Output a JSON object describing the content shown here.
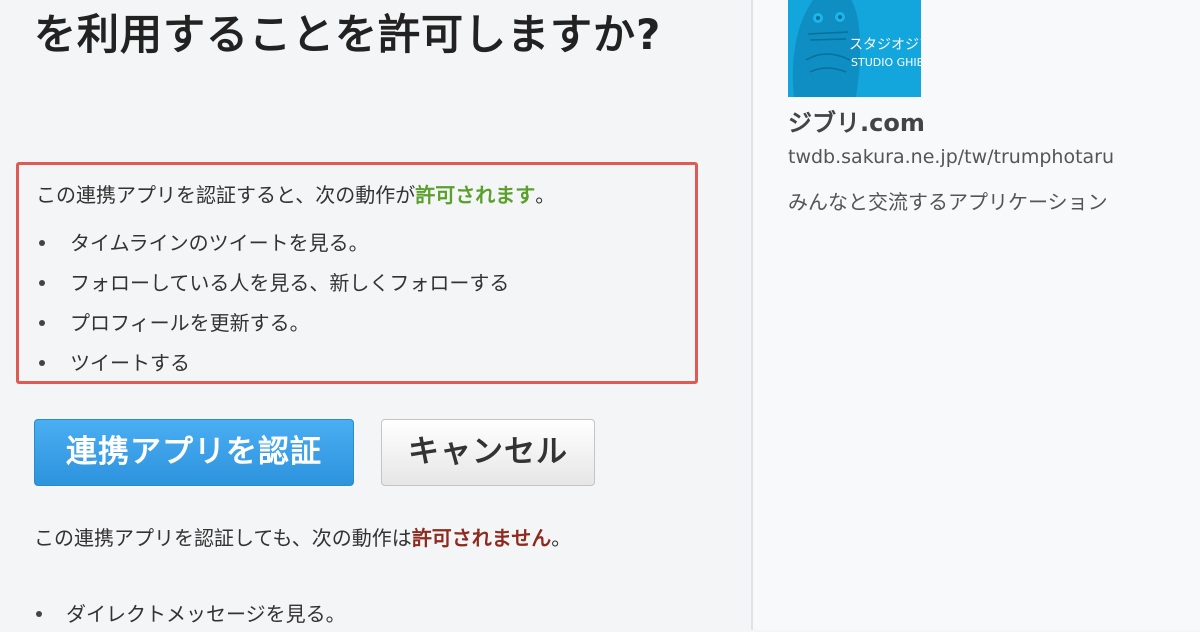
{
  "main": {
    "title": "ジブリ.comがあなたのアカウントを利用することを許可しますか?",
    "allowed": {
      "intro": "この連携アプリを認証すると、次の動作が",
      "highlight": "許可されます",
      "suffix": "。",
      "highlight_color": "#5aa02c",
      "items": [
        "タイムラインのツイートを見る。",
        "フォローしている人を見る、新しくフォローする",
        "プロフィールを更新する。",
        "ツイートする"
      ]
    },
    "buttons": {
      "authorize_label": "連携アプリを認証",
      "cancel_label": "キャンセル",
      "authorize_color": "#2d93dd"
    },
    "denied": {
      "intro": "この連携アプリを認証しても、次の動作は",
      "highlight": "許可されません",
      "suffix": "。",
      "highlight_color": "#8e2a1e",
      "items": [
        "ダイレクトメッセージを見る。"
      ]
    }
  },
  "app": {
    "logo_text_ja": "スタジオジブリ",
    "logo_text_en": "STUDIO GHIBLI",
    "logo_color": "#12a6dd",
    "name": "ジブリ.com",
    "url": "twdb.sakura.ne.jp/tw/trumphotaru",
    "description": "みんなと交流するアプリケーション"
  },
  "highlight_border_color": "#e05a55"
}
